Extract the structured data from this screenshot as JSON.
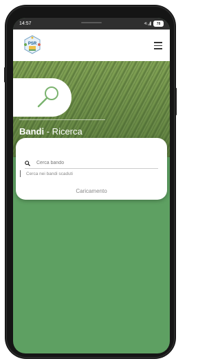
{
  "status_bar": {
    "time": "14:57",
    "signal": "⁴⁵ ₊ıll",
    "battery": "78"
  },
  "header": {
    "logo_text": "PSR"
  },
  "hero": {
    "title_bold": "Bandi",
    "title_rest": " - Ricerca"
  },
  "search": {
    "placeholder": "Cerca bando",
    "expired_checkbox_label": "Cerca nei bandi scaduti",
    "loading_text": "Caricamento"
  },
  "colors": {
    "brand_green": "#5ea062",
    "status_bar": "#2f2f2f"
  }
}
